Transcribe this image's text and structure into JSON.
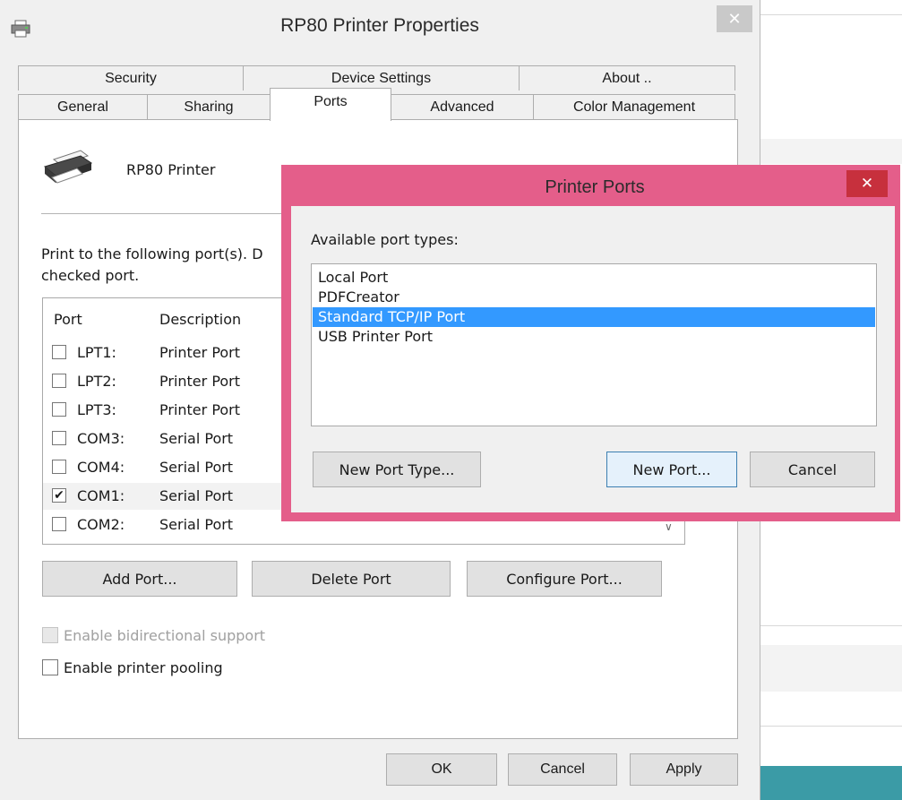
{
  "window": {
    "title": "RP80 Printer Properties",
    "close_glyph": "✕"
  },
  "tabs_row1": [
    {
      "label": "Security"
    },
    {
      "label": "Device Settings"
    },
    {
      "label": "About .."
    }
  ],
  "tabs_row2": [
    {
      "label": "General"
    },
    {
      "label": "Sharing"
    },
    {
      "label": "Ports",
      "active": true
    },
    {
      "label": "Advanced"
    },
    {
      "label": "Color Management"
    }
  ],
  "ports_tab": {
    "printer_name": "RP80 Printer",
    "description": "Print to the following port(s). D checked port.",
    "description_line1": "Print to the following port(s). D",
    "description_line2": "checked port.",
    "col_port": "Port",
    "col_description": "Description",
    "ports": [
      {
        "name": "LPT1:",
        "description": "Printer Port",
        "checked": false
      },
      {
        "name": "LPT2:",
        "description": "Printer Port",
        "checked": false
      },
      {
        "name": "LPT3:",
        "description": "Printer Port",
        "checked": false
      },
      {
        "name": "COM3:",
        "description": "Serial Port",
        "checked": false
      },
      {
        "name": "COM4:",
        "description": "Serial Port",
        "checked": false
      },
      {
        "name": "COM1:",
        "description": "Serial Port",
        "checked": true
      },
      {
        "name": "COM2:",
        "description": "Serial Port",
        "checked": false
      }
    ],
    "add_port": "Add Port...",
    "delete_port": "Delete Port",
    "configure_port": "Configure Port...",
    "bidirectional": "Enable bidirectional support",
    "pooling": "Enable printer pooling"
  },
  "footer": {
    "ok": "OK",
    "cancel": "Cancel",
    "apply": "Apply"
  },
  "dialog": {
    "title": "Printer Ports",
    "close_glyph": "✕",
    "label": "Available port types:",
    "types": [
      {
        "label": "Local Port",
        "selected": false
      },
      {
        "label": "PDFCreator",
        "selected": false
      },
      {
        "label": "Standard TCP/IP Port",
        "selected": true
      },
      {
        "label": "USB Printer Port",
        "selected": false
      }
    ],
    "new_port_type": "New Port Type...",
    "new_port": "New Port...",
    "cancel": "Cancel"
  },
  "colors": {
    "dialog_border": "#e45e8a",
    "dialog_close": "#c7303d",
    "selection": "#3399ff",
    "teal_strip": "#3b9ba6"
  }
}
